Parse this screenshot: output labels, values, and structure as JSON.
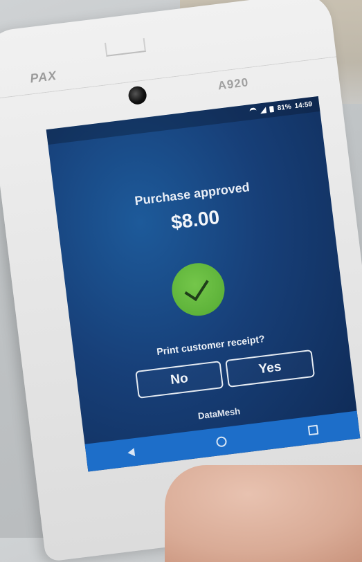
{
  "device": {
    "brand": "PAX",
    "model": "A920"
  },
  "status_bar": {
    "battery": "81%",
    "time": "14:59"
  },
  "payment": {
    "title": "Purchase approved",
    "amount": "$8.00"
  },
  "receipt_prompt": {
    "question": "Print customer receipt?",
    "no_label": "No",
    "yes_label": "Yes"
  },
  "provider": "DataMesh",
  "navigation": {
    "back_icon": "back-triangle-icon",
    "home_icon": "home-circle-icon",
    "recent_icon": "recent-apps-square-icon"
  },
  "colors": {
    "screen_bg": "#173f78",
    "nav_bar": "#1d6ec9",
    "success_green": "#5eb33a"
  }
}
